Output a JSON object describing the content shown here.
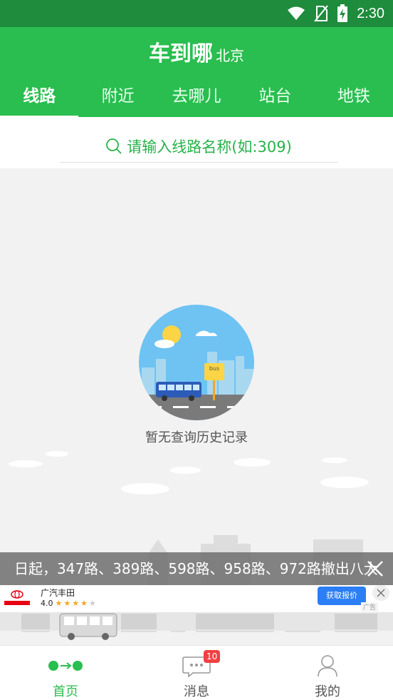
{
  "status_bar": {
    "time": "2:30"
  },
  "header": {
    "title": "车到哪",
    "city": "北京"
  },
  "tabs": [
    {
      "label": "线路",
      "active": true
    },
    {
      "label": "附近",
      "active": false
    },
    {
      "label": "去哪儿",
      "active": false
    },
    {
      "label": "站台",
      "active": false
    },
    {
      "label": "地铁",
      "active": false
    }
  ],
  "search": {
    "placeholder": "请输入线路名称(如:309)"
  },
  "empty_state": {
    "message": "暂无查询历史记录",
    "sign_text": "bus"
  },
  "ticker": {
    "text": "日起，347路、389路、598路、958路、972路撤出八大"
  },
  "ad": {
    "brand": "广汽丰田",
    "rating": "4.0",
    "stars_filled": 4,
    "stars_total": 5,
    "cta": "获取报价",
    "tag": "广告",
    "brand_color": "#e60012"
  },
  "bottom_nav": {
    "items": [
      {
        "label": "首页",
        "active": true
      },
      {
        "label": "消息",
        "active": false
      },
      {
        "label": "我的",
        "active": false
      }
    ],
    "messages_badge": "10"
  },
  "colors": {
    "primary": "#29be4f",
    "status_bar": "#1e8c3c",
    "cta": "#2b7ef5",
    "badge": "#f04141"
  }
}
